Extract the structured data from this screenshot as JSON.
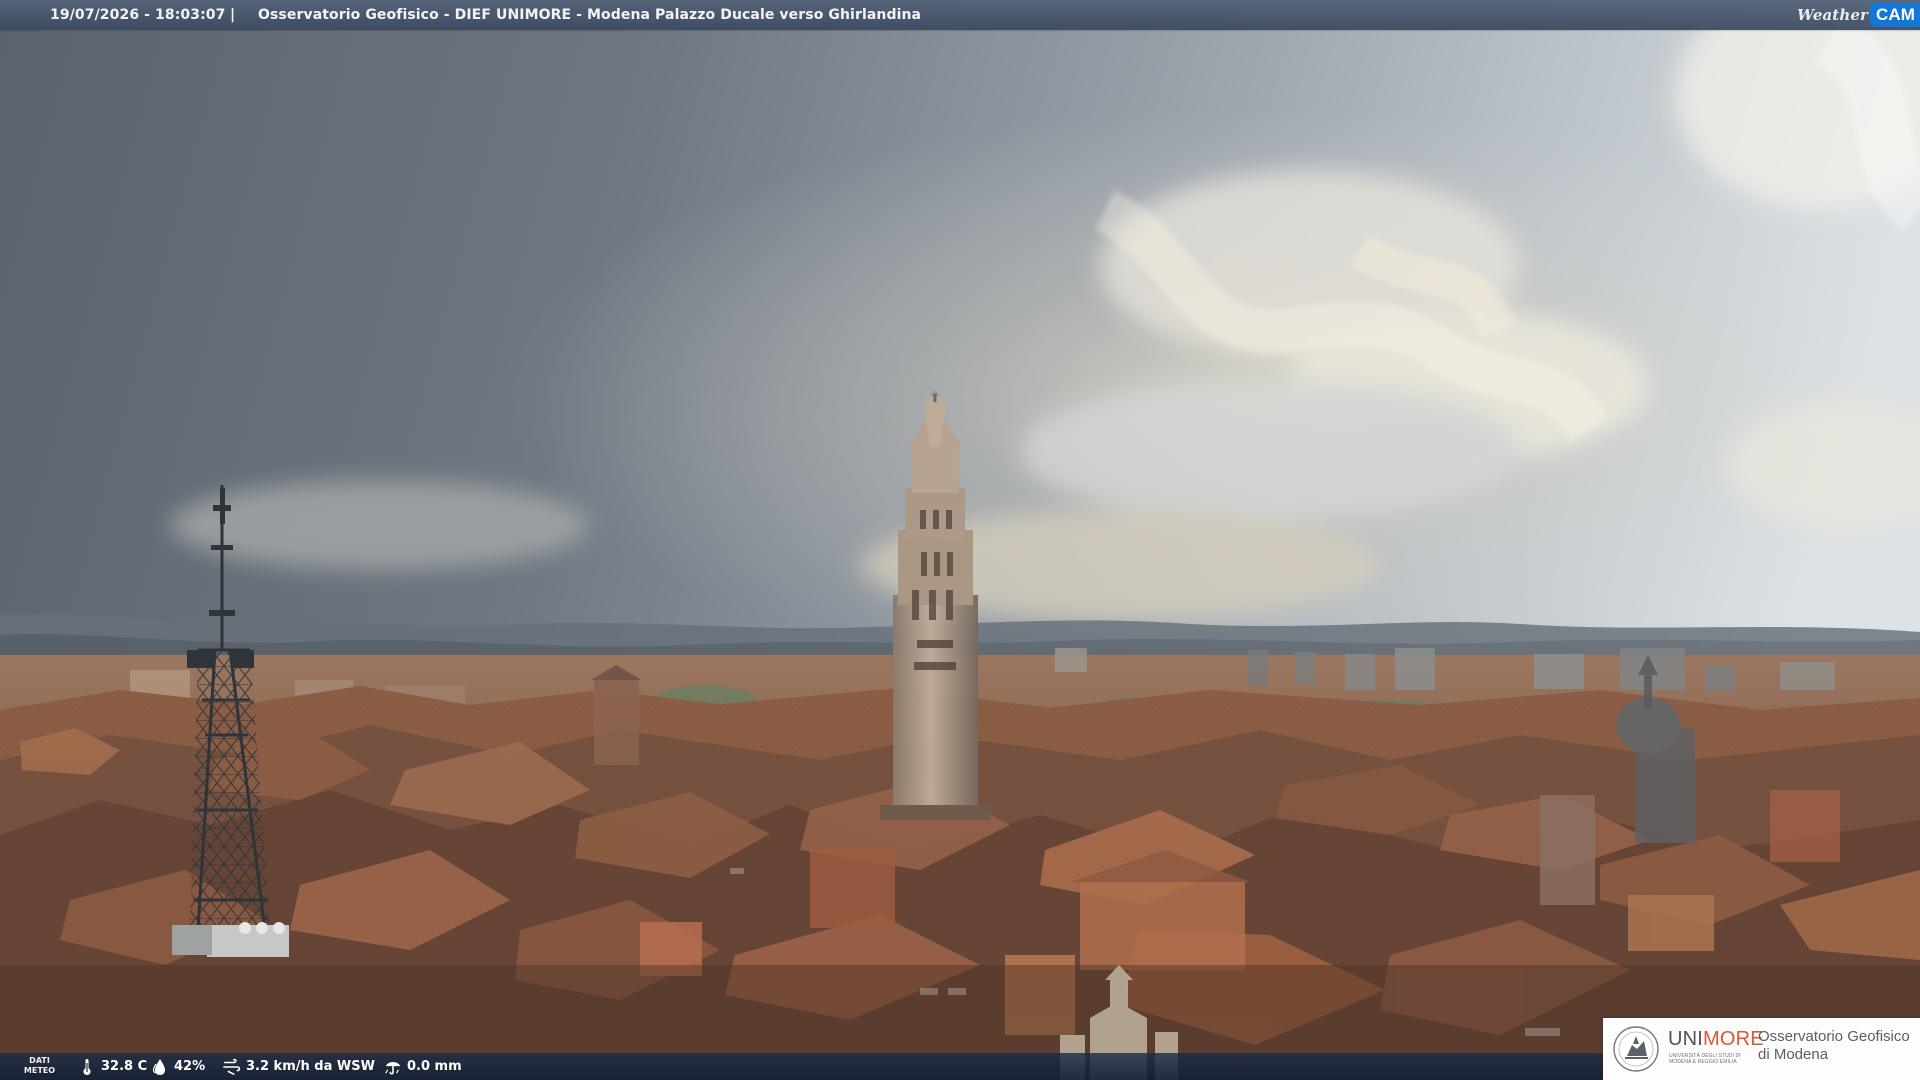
{
  "overlay": {
    "timestamp": "19/07/2026 - 18:03:07",
    "separator": "|",
    "camera_title": "Osservatorio Geofisico - DIEF UNIMORE - Modena Palazzo Ducale verso Ghirlandina",
    "logo": {
      "weather_text": "Weather",
      "cam_text": "CAM",
      "accent_color": "#1377d8"
    }
  },
  "weather_data": {
    "label_line_1": "DATI",
    "label_line_2": "METEO",
    "temperature": "32.8 C",
    "humidity": "42%",
    "wind": "3.2 km/h da WSW",
    "rain": "0.0 mm",
    "icons": {
      "temperature": "thermometer-icon",
      "humidity": "water-drop-icon",
      "wind": "wind-icon",
      "rain": "rain-gauge-icon"
    }
  },
  "institution": {
    "brand_prefix": "UNI",
    "brand_suffix": "MORE",
    "university_line_1": "Università degli Studi di",
    "university_line_2": "Modena e Reggio Emilia",
    "observatory_line_1": "Osservatorio Geofisico",
    "observatory_line_2": "di Modena",
    "brand_accent": "#d85a2e"
  },
  "scene": {
    "landmark": "Ghirlandina",
    "sky_color": "#7f8790",
    "roof_color": "#8a5c3f"
  }
}
